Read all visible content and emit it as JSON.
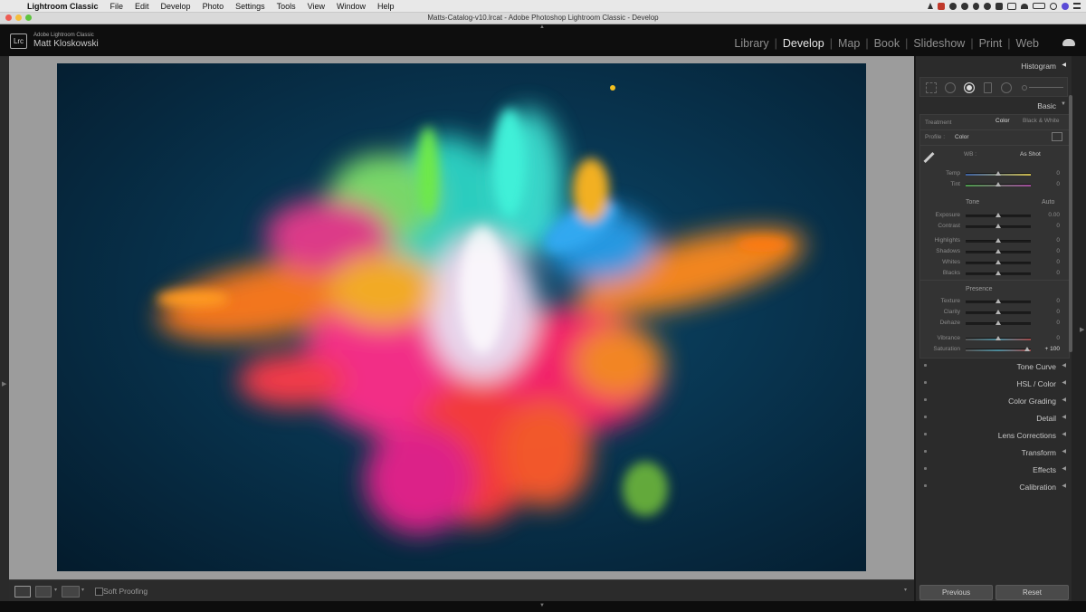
{
  "menubar": {
    "apple_glyph": "",
    "items": [
      "Lightroom Classic",
      "File",
      "Edit",
      "Develop",
      "Photo",
      "Settings",
      "Tools",
      "View",
      "Window",
      "Help"
    ]
  },
  "window": {
    "title": "Matts-Catalog-v10.lrcat - Adobe Photoshop Lightroom Classic - Develop"
  },
  "identity": {
    "logo_text": "Lrc",
    "product": "Adobe Lightroom Classic",
    "user": "Matt Kloskowski"
  },
  "modules": [
    {
      "label": "Library",
      "active": false
    },
    {
      "label": "Develop",
      "active": true
    },
    {
      "label": "Map",
      "active": false
    },
    {
      "label": "Book",
      "active": false
    },
    {
      "label": "Slideshow",
      "active": false
    },
    {
      "label": "Print",
      "active": false
    },
    {
      "label": "Web",
      "active": false
    }
  ],
  "toolbar": {
    "soft_proofing": "Soft Proofing"
  },
  "panels": {
    "histogram": "Histogram",
    "basic": "Basic",
    "treatment_label": "Treatment",
    "treatment_color": "Color",
    "treatment_bw": "Black & White",
    "profile_label": "Profile :",
    "profile_value": "Color",
    "wb_label": "WB :",
    "wb_value": "As Shot",
    "tone_label": "Tone",
    "tone_auto": "Auto",
    "presence_label": "Presence",
    "sliders": [
      {
        "label": "Temp",
        "value": "0",
        "position": 0.5
      },
      {
        "label": "Tint",
        "value": "0",
        "position": 0.5
      },
      {
        "label": "Exposure",
        "value": "0.00",
        "position": 0.5
      },
      {
        "label": "Contrast",
        "value": "0",
        "position": 0.5
      },
      {
        "label": "Highlights",
        "value": "0",
        "position": 0.5
      },
      {
        "label": "Shadows",
        "value": "0",
        "position": 0.5
      },
      {
        "label": "Whites",
        "value": "0",
        "position": 0.5
      },
      {
        "label": "Blacks",
        "value": "0",
        "position": 0.5
      },
      {
        "label": "Texture",
        "value": "0",
        "position": 0.5
      },
      {
        "label": "Clarity",
        "value": "0",
        "position": 0.5
      },
      {
        "label": "Dehaze",
        "value": "0",
        "position": 0.5
      },
      {
        "label": "Vibrance",
        "value": "0",
        "position": 0.5
      },
      {
        "label": "Saturation",
        "value": "+ 100",
        "position": 0.95
      }
    ],
    "collapsed": [
      {
        "label": "Tone Curve"
      },
      {
        "label": "HSL / Color"
      },
      {
        "label": "Color Grading"
      },
      {
        "label": "Detail"
      },
      {
        "label": "Lens Corrections"
      },
      {
        "label": "Transform"
      },
      {
        "label": "Effects"
      },
      {
        "label": "Calibration"
      }
    ]
  },
  "buttons": {
    "previous": "Previous",
    "reset": "Reset"
  },
  "colors": {
    "panel_bg": "#2b2b2b",
    "canvas_bg": "#9c9c9c",
    "photo_bg": "#08344f"
  }
}
